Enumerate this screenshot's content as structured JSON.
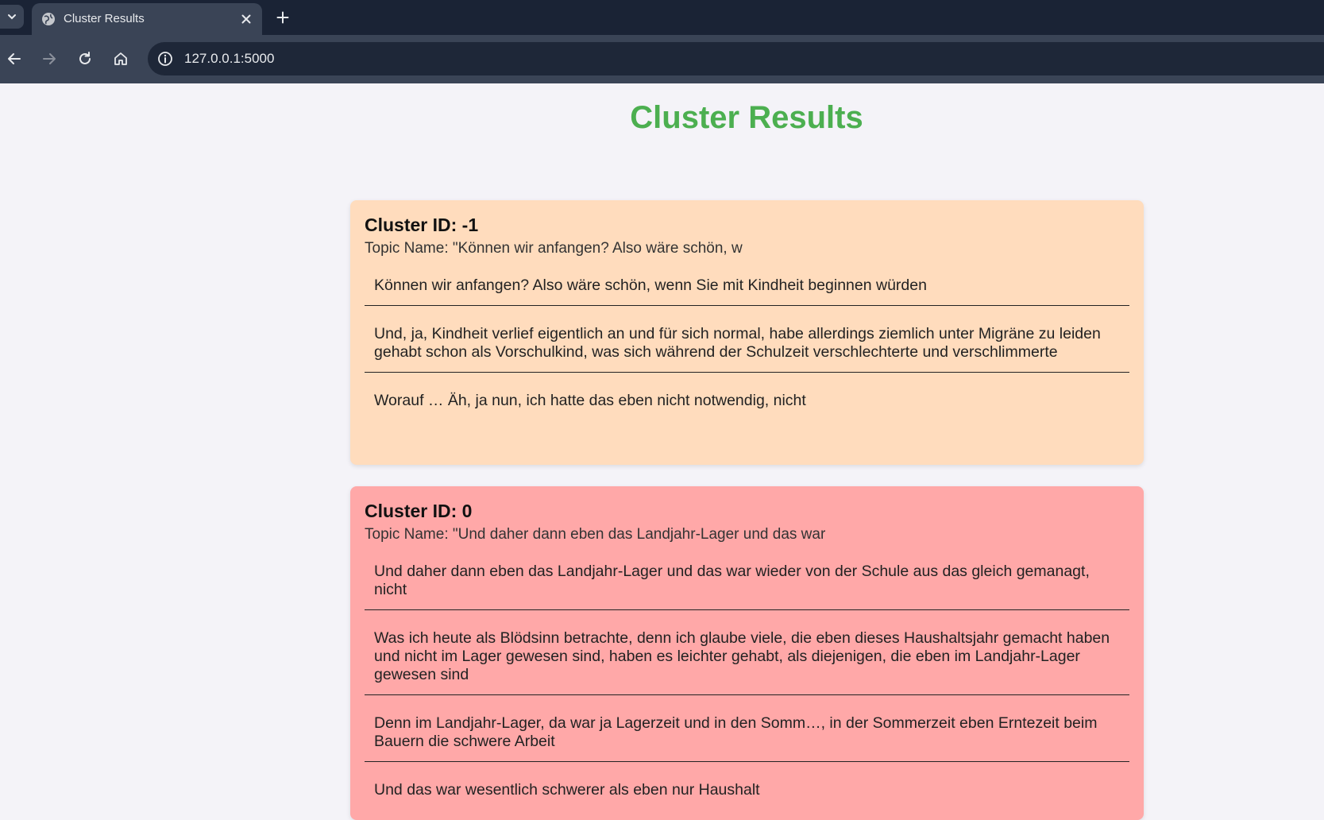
{
  "browser": {
    "tab_title": "Cluster Results",
    "url": "127.0.0.1:5000",
    "colors": {
      "tabstrip": "#1a2335",
      "toolbar": "#3a4456",
      "omnibox": "#1e2738"
    }
  },
  "page": {
    "title": "Cluster Results",
    "title_color": "#4caf50"
  },
  "clusters": [
    {
      "id_label": "Cluster ID: -1",
      "topic_label": "Topic Name: \"Können wir anfangen? Also wäre schön, w",
      "color": "#ffdcbd",
      "sentences": [
        "Können wir anfangen? Also wäre schön, wenn Sie mit Kindheit beginnen würden",
        "Und, ja, Kindheit verlief eigentlich an und für sich normal, habe allerdings ziemlich unter Migräne zu leiden gehabt schon als Vorschulkind, was sich während der Schulzeit verschlechterte und verschlimmerte",
        "Worauf … Äh, ja nun, ich hatte das eben nicht notwendig, nicht"
      ]
    },
    {
      "id_label": "Cluster ID: 0",
      "topic_label": "Topic Name: \"Und daher dann eben das Landjahr-Lager und das war",
      "color": "#ffa8a8",
      "sentences": [
        "Und daher dann eben das Landjahr-Lager und das war wieder von der Schule aus das gleich gemanagt, nicht",
        "Was ich heute als Blödsinn betrachte, denn ich glaube viele, die eben dieses Haushaltsjahr gemacht haben und nicht im Lager gewesen sind, haben es leichter gehabt, als diejenigen, die eben im Landjahr-Lager gewesen sind",
        "Denn im Landjahr-Lager, da war ja Lagerzeit und in den Somm…, in der Sommerzeit eben Erntezeit beim Bauern die schwere Arbeit",
        "Und das war wesentlich schwerer als eben nur Haushalt"
      ]
    }
  ]
}
